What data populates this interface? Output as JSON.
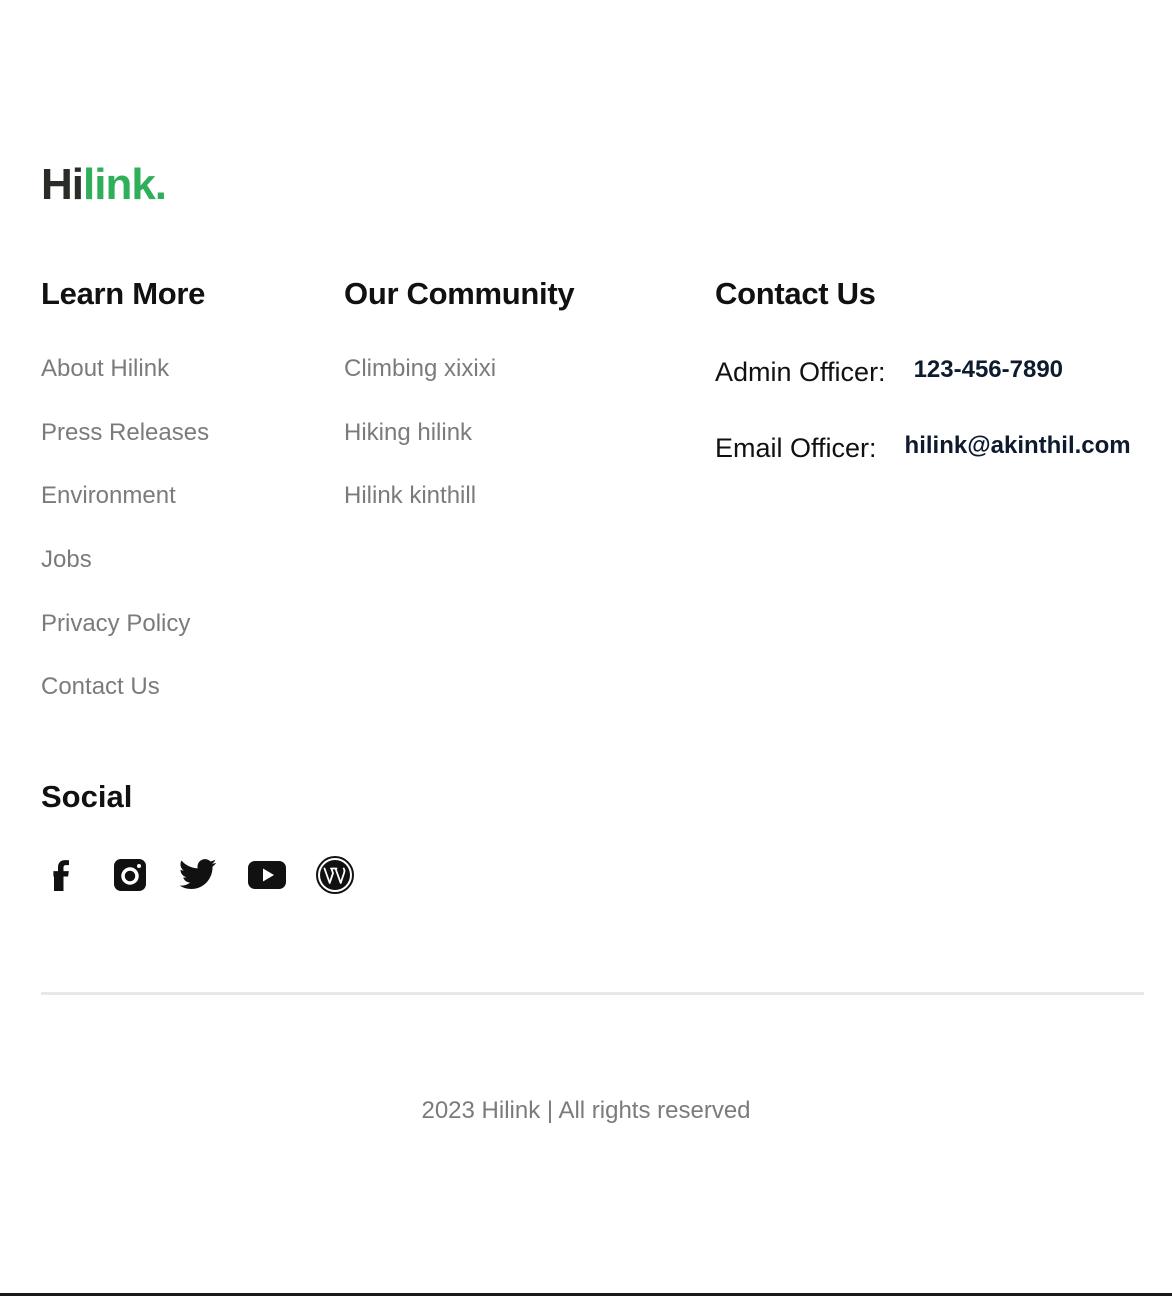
{
  "brand": {
    "logo_dark": "Hi",
    "logo_green": "link.",
    "accent_color": "#30AF5B"
  },
  "learn_more": {
    "heading": "Learn More",
    "links": [
      "About Hilink",
      "Press Releases",
      "Environment",
      "Jobs",
      "Privacy Policy",
      "Contact Us"
    ]
  },
  "community": {
    "heading": "Our Community",
    "links": [
      "Climbing xixixi",
      "Hiking hilink",
      "Hilink kinthill"
    ]
  },
  "contact": {
    "heading": "Contact Us",
    "admin_label": "Admin Officer:",
    "admin_value": "123-456-7890",
    "email_label": "Email Officer:",
    "email_value": "hilink@akinthil.com"
  },
  "social": {
    "heading": "Social",
    "icons": [
      "facebook-icon",
      "instagram-icon",
      "twitter-icon",
      "youtube-icon",
      "wordpress-icon"
    ]
  },
  "footer": {
    "copyright": "2023 Hilink | All rights reserved"
  }
}
